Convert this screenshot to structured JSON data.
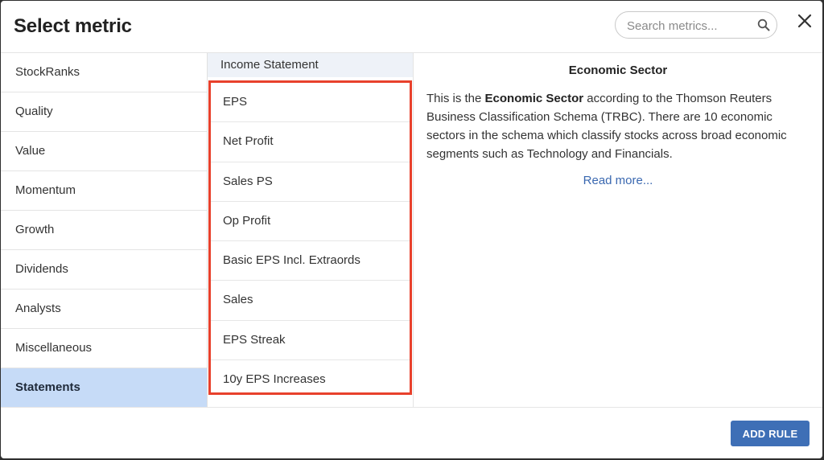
{
  "dialog": {
    "title": "Select metric",
    "close_icon": "close-icon"
  },
  "search": {
    "placeholder": "Search metrics...",
    "value": "",
    "icon": "search-icon"
  },
  "categories": [
    {
      "label": "StockRanks",
      "active": false
    },
    {
      "label": "Quality",
      "active": false
    },
    {
      "label": "Value",
      "active": false
    },
    {
      "label": "Momentum",
      "active": false
    },
    {
      "label": "Growth",
      "active": false
    },
    {
      "label": "Dividends",
      "active": false
    },
    {
      "label": "Analysts",
      "active": false
    },
    {
      "label": "Miscellaneous",
      "active": false
    },
    {
      "label": "Statements",
      "active": true
    }
  ],
  "metrics_panel": {
    "header": "Income Statement",
    "highlight_color": "#e8412c",
    "items": [
      "EPS",
      "Net Profit",
      "Sales PS",
      "Op Profit",
      "Basic EPS Incl. Extraords",
      "Sales",
      "EPS Streak",
      "10y EPS Increases"
    ]
  },
  "detail": {
    "title": "Economic Sector",
    "text_before": "This is the ",
    "text_bold": "Economic Sector",
    "text_after": " according to the Thomson Reuters Business Classification Schema (TRBC). There are 10 economic sectors in the schema which classify stocks across broad economic segments such as Technology and Financials.",
    "read_more": "Read more..."
  },
  "footer": {
    "add_rule_label": "ADD RULE"
  },
  "colors": {
    "active_category_bg": "#c6dbf7",
    "primary_button": "#3e6fb6",
    "link": "#3a68b0"
  }
}
